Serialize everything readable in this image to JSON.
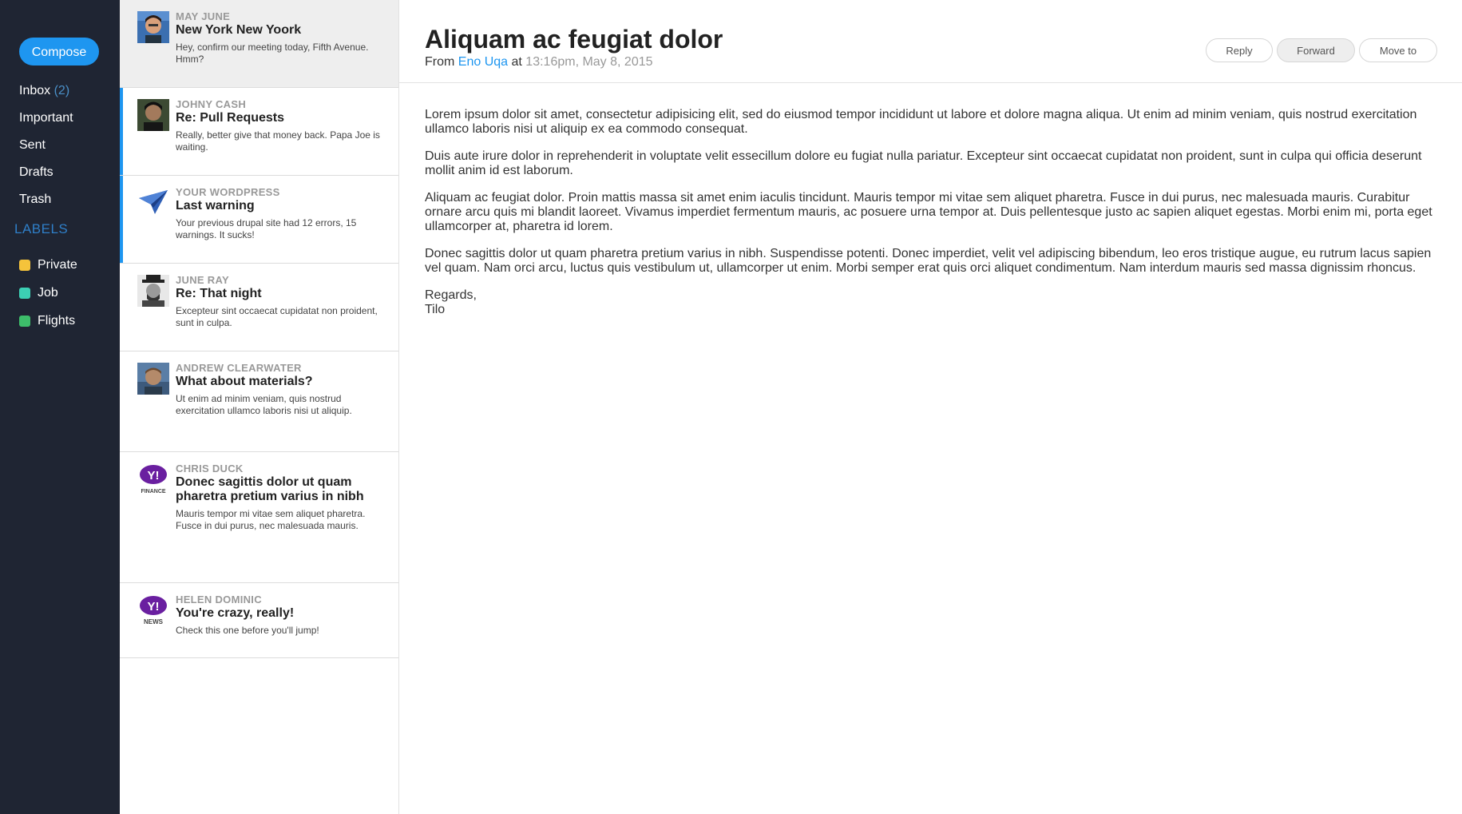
{
  "sidebar": {
    "compose_label": "Compose",
    "nav": [
      {
        "label": "Inbox",
        "count": "(2)"
      },
      {
        "label": "Important",
        "count": ""
      },
      {
        "label": "Sent",
        "count": ""
      },
      {
        "label": "Drafts",
        "count": ""
      },
      {
        "label": "Trash",
        "count": ""
      }
    ],
    "labels_heading": "LABELS",
    "labels": [
      {
        "label": "Private",
        "color": "#f5c33b"
      },
      {
        "label": "Job",
        "color": "#3ccfb4"
      },
      {
        "label": "Flights",
        "color": "#3dbd6a"
      }
    ]
  },
  "messages": [
    {
      "sender": "MAY JUNE",
      "subject": "New York New Yoork",
      "preview": "Hey, confirm our meeting today, Fifth Avenue. Hmm?",
      "avatar": "person-photo"
    },
    {
      "sender": "JOHNY CASH",
      "subject": "Re: Pull Requests",
      "preview": "Really, better give that money back. Papa Joe is waiting.",
      "avatar": "person-photo"
    },
    {
      "sender": "YOUR WORDPRESS",
      "subject": "Last warning",
      "preview": "Your previous drupal site had 12 errors, 15 warnings. It sucks!",
      "avatar": "paper-plane-logo"
    },
    {
      "sender": "JUNE RAY",
      "subject": "Re: That night",
      "preview": "Excepteur sint occaecat cupidatat non proident, sunt in culpa.",
      "avatar": "person-photo"
    },
    {
      "sender": "ANDREW CLEARWATER",
      "subject": "What about materials?",
      "preview": "Ut enim ad minim veniam, quis nostrud exercitation ullamco laboris nisi ut aliquip.",
      "avatar": "person-photo"
    },
    {
      "sender": "CHRIS DUCK",
      "subject": "Donec sagittis dolor ut quam pharetra pretium varius in nibh",
      "preview": "Mauris tempor mi vitae sem aliquet pharetra. Fusce in dui purus, nec malesuada mauris.",
      "avatar": "yahoo-finance-logo",
      "logo_text": "Y!",
      "logo_sub": "FINANCE"
    },
    {
      "sender": "HELEN DOMINIC",
      "subject": "You're crazy, really!",
      "preview": "Check this one before you'll jump!",
      "avatar": "yahoo-news-logo",
      "logo_text": "Y!",
      "logo_sub": "NEWS"
    }
  ],
  "reader": {
    "title": "Aliquam ac feugiat dolor",
    "from_label": "From",
    "sender": "Eno Uqa",
    "at_label": "at",
    "timestamp": "13:16pm, May 8, 2015",
    "actions": {
      "reply": "Reply",
      "forward": "Forward",
      "move": "Move to"
    },
    "body": [
      "Lorem ipsum dolor sit amet, consectetur adipisicing elit, sed do eiusmod tempor incididunt ut labore et dolore magna aliqua. Ut enim ad minim veniam, quis nostrud exercitation ullamco laboris nisi ut aliquip ex ea commodo consequat.",
      "Duis aute irure dolor in reprehenderit in voluptate velit essecillum dolore eu fugiat nulla pariatur. Excepteur sint occaecat cupidatat non proident, sunt in culpa qui officia deserunt mollit anim id est laborum.",
      "Aliquam ac feugiat dolor. Proin mattis massa sit amet enim iaculis tincidunt. Mauris tempor mi vitae sem aliquet pharetra. Fusce in dui purus, nec malesuada mauris. Curabitur ornare arcu quis mi blandit laoreet. Vivamus imperdiet fermentum mauris, ac posuere urna tempor at. Duis pellentesque justo ac sapien aliquet egestas. Morbi enim mi, porta eget ullamcorper at, pharetra id lorem.",
      "Donec sagittis dolor ut quam pharetra pretium varius in nibh. Suspendisse potenti. Donec imperdiet, velit vel adipiscing bibendum, leo eros tristique augue, eu rutrum lacus sapien vel quam. Nam orci arcu, luctus quis vestibulum ut, ullamcorper ut enim. Morbi semper erat quis orci aliquet condimentum. Nam interdum mauris sed massa dignissim rhoncus."
    ],
    "signoff": "Regards,",
    "signature": "Tilo"
  },
  "colors": {
    "accent": "#1e96f0",
    "sidebar_bg": "#1f2533"
  }
}
